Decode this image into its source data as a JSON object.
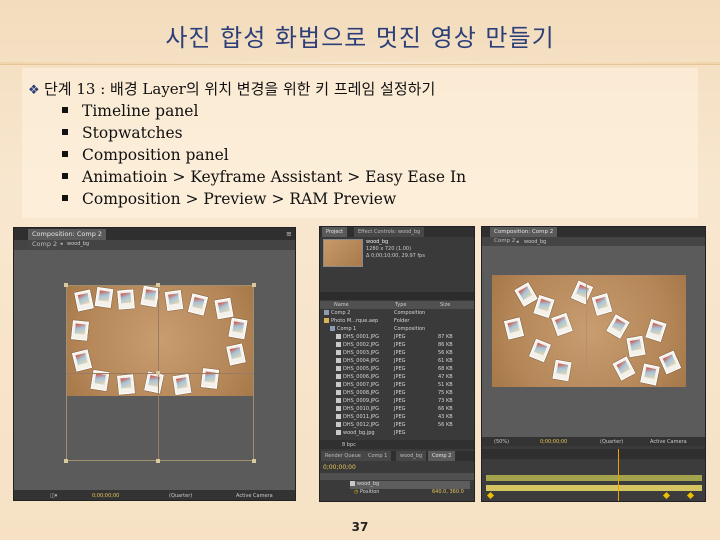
{
  "slide": {
    "title": "사진 합성 화법으로 멋진 영상 만들기",
    "step": "단계 13 : 배경 Layer의 위치 변경을 위한 키 프레임 설정하기",
    "items": [
      "Timeline panel",
      "Stopwatches",
      "Composition panel",
      "Animatioin > Keyframe Assistant > Easy Ease In",
      "Composition > Preview > RAM Preview"
    ],
    "page_number": "37"
  },
  "left_shot": {
    "tab": "Composition: Comp 2",
    "breadcrumb_comp": "Comp 2",
    "breadcrumb_layer": "wood_bg",
    "timecode": "0;00;00;00",
    "quality": "(Quarter)",
    "camera": "Active Camera"
  },
  "right_project": {
    "tabs": [
      "Project",
      "Effect Controls: wood_bg"
    ],
    "asset_name": "wood_bg",
    "asset_info_1": "1280 x 720 (1.00)",
    "asset_info_2": "Δ 0;00;10;00, 29.97 fps",
    "columns": {
      "name": "Name",
      "type": "Type",
      "size": "Size"
    },
    "files": [
      {
        "name": "Comp 2",
        "type": "Composition",
        "size": ""
      },
      {
        "name": "Photo M...rque.aep",
        "type": "Folder",
        "size": ""
      },
      {
        "name": "Comp 1",
        "type": "Composition",
        "size": ""
      },
      {
        "name": "DHS_0001.JPG",
        "type": "JPEG",
        "size": "87 KB"
      },
      {
        "name": "DHS_0002.JPG",
        "type": "JPEG",
        "size": "86 KB"
      },
      {
        "name": "DHS_0003.JPG",
        "type": "JPEG",
        "size": "56 KB"
      },
      {
        "name": "DHS_0004.JPG",
        "type": "JPEG",
        "size": "61 KB"
      },
      {
        "name": "DHS_0005.JPG",
        "type": "JPEG",
        "size": "68 KB"
      },
      {
        "name": "DHS_0006.JPG",
        "type": "JPEG",
        "size": "47 KB"
      },
      {
        "name": "DHS_0007.JPG",
        "type": "JPEG",
        "size": "51 KB"
      },
      {
        "name": "DHS_0008.JPG",
        "type": "JPEG",
        "size": "75 KB"
      },
      {
        "name": "DHS_0009.JPG",
        "type": "JPEG",
        "size": "73 KB"
      },
      {
        "name": "DHS_0010.JPG",
        "type": "JPEG",
        "size": "66 KB"
      },
      {
        "name": "DHS_0011.JPG",
        "type": "JPEG",
        "size": "43 KB"
      },
      {
        "name": "DHS_0012.JPG",
        "type": "JPEG",
        "size": "56 KB"
      },
      {
        "name": "wood_bg.jpg",
        "type": "JPEG",
        "size": ""
      }
    ],
    "bpc": "8 bpc",
    "tabs_bottom": [
      "Render Queue",
      "Comp 1",
      "wood_bg",
      "Comp 2"
    ],
    "timecode": "0;00;00;00",
    "layers": [
      "wood_bg",
      "Position"
    ],
    "position_value": "640.0, 360.0"
  },
  "right_shot": {
    "tab": "Composition: Comp 2",
    "breadcrumb_comp": "Comp 2",
    "breadcrumb_layer": "wood_bg",
    "zoom": "(50%)",
    "timecode": "0;00;00;00",
    "quality": "(Quarter)",
    "camera": "Active Camera"
  }
}
